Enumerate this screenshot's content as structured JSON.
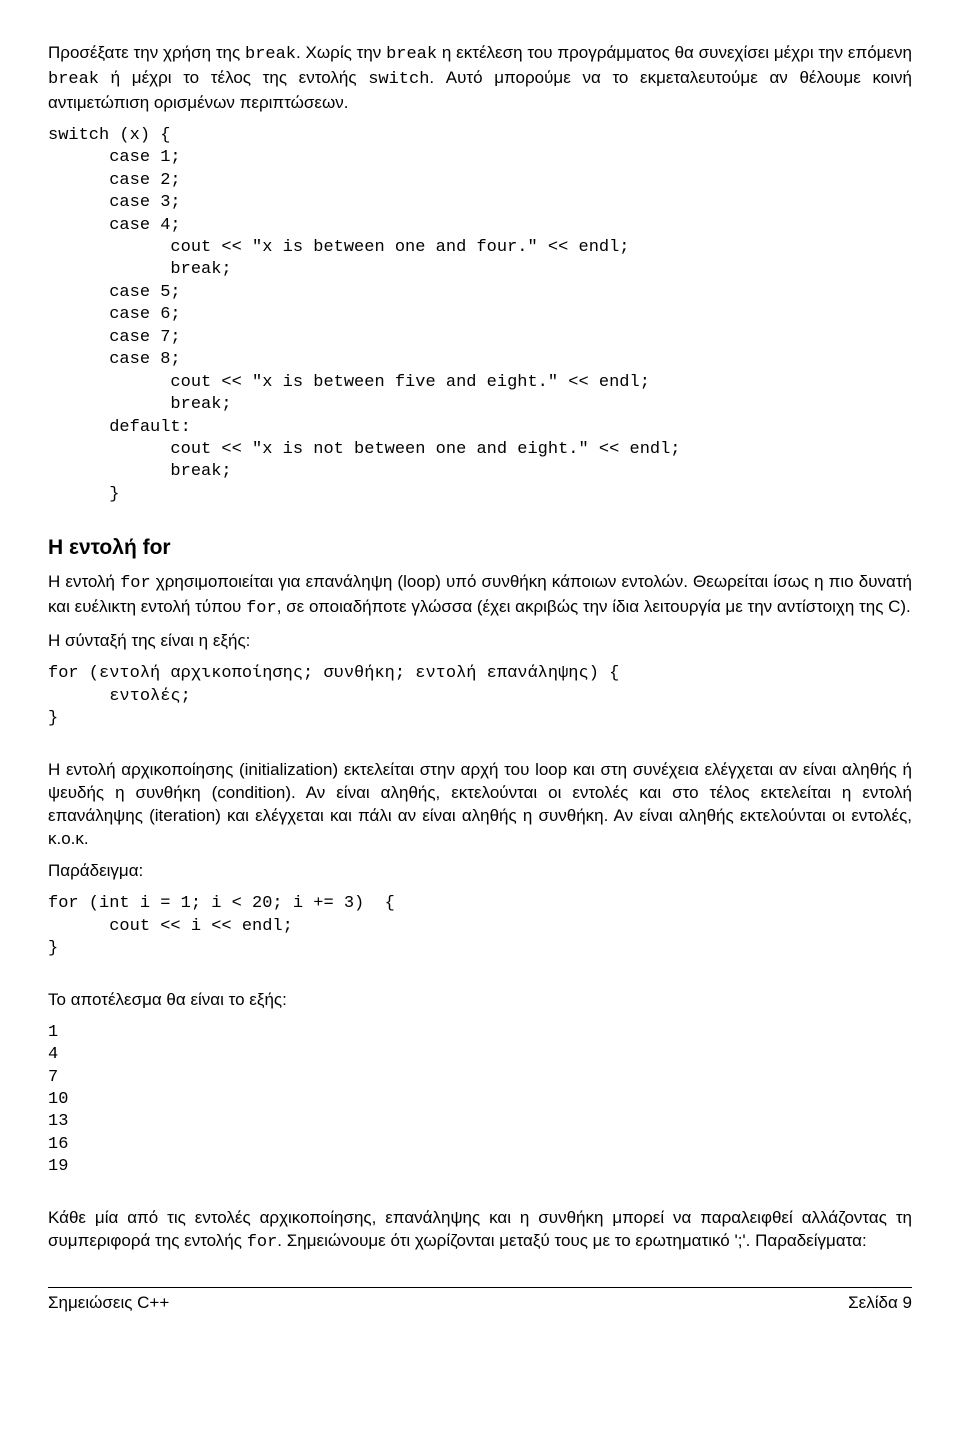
{
  "intro": {
    "p1a": "Προσέξατε την χρήση της ",
    "p1b": "break",
    "p1c": ". Χωρίς την ",
    "p1d": "break",
    "p1e": " η εκτέλεση του προγράμματος θα συνεχίσει μέχρι την επόμενη ",
    "p1f": "break",
    "p1g": " ή μέχρι το τέλος της εντολής ",
    "p1h": "switch",
    "p1i": ". Αυτό μπορούμε να το εκμεταλευτούμε αν θέλουμε κοινή αντιμετώπιση ορισμένων περιπτώσεων."
  },
  "code1": "switch (x) {\n      case 1;\n      case 2;\n      case 3;\n      case 4;\n            cout << \"x is between one and four.\" << endl;\n            break;\n      case 5;\n      case 6;\n      case 7;\n      case 8;\n            cout << \"x is between five and eight.\" << endl;\n            break;\n      default:\n            cout << \"x is not between one and eight.\" << endl;\n            break;\n      }",
  "for_section": {
    "title": "Η εντολή for",
    "p1a": "Η εντολή ",
    "p1b": "for",
    "p1c": " χρησιμοποιείται για επανάληψη (loop) υπό συνθήκη κάποιων εντολών. Θεωρείται ίσως η πιο δυνατή και ευέλικτη εντολή τύπου ",
    "p1d": "for",
    "p1e": ", σε οποιαδήποτε γλώσσα (έχει ακριβώς την ίδια λειτουργία με την αντίστοιχη της C).",
    "p2": "Η σύνταξή της είναι η εξής:",
    "code2": "for (εντολή αρχικοποίησης; συνθήκη; εντολή επανάληψης) {\n      εντολές;\n}",
    "p3": "Η εντολή αρχικοποίησης (initialization) εκτελείται στην αρχή του loop και στη συνέχεια ελέγχεται αν είναι αληθής ή ψευδής η συνθήκη (condition). Αν είναι αληθής, εκτελούνται οι εντολές και στο τέλος εκτελείται η εντολή επανάληψης (iteration) και ελέγχεται και πάλι αν είναι αληθής η συνθήκη. Αν είναι αληθής εκτελούνται οι εντολές, κ.ο.κ.",
    "p4": "Παράδειγμα:",
    "code3": "for (int i = 1; i < 20; i += 3)  {\n      cout << i << endl;\n}",
    "p5": "Το αποτέλεσμα θα είναι το εξής:",
    "code4": "1\n4\n7\n10\n13\n16\n19",
    "p6a": "Κάθε μία από τις εντολές αρχικοποίησης, επανάληψης και η συνθήκη μπορεί να παραλειφθεί αλλάζοντας τη συμπεριφορά της εντολής ",
    "p6b": "for",
    "p6c": ". Σημειώνουμε ότι χωρίζονται μεταξύ τους με το ερωτηματικό ';'. Παραδείγματα:"
  },
  "footer": {
    "left": "Σημειώσεις C++",
    "right": "Σελίδα 9"
  }
}
